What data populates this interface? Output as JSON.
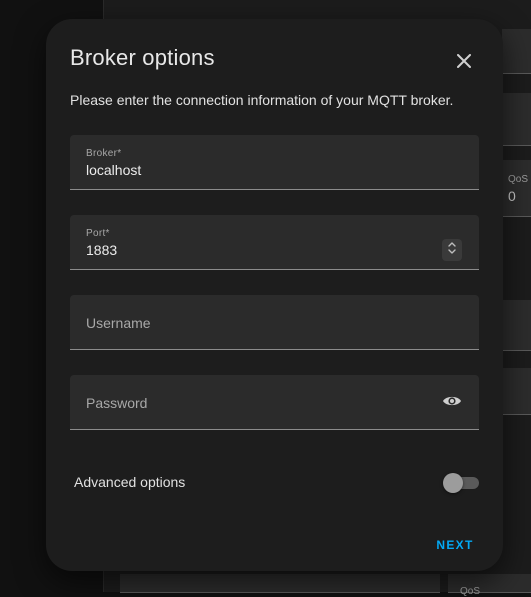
{
  "background": {
    "qos_label": "QoS",
    "qos_value": "0",
    "qos_label_bottom": "QoS"
  },
  "dialog": {
    "title": "Broker options",
    "description": "Please enter the connection information of your MQTT broker.",
    "fields": {
      "broker": {
        "label": "Broker*",
        "value": "localhost"
      },
      "port": {
        "label": "Port*",
        "value": "1883"
      },
      "username": {
        "label": "Username",
        "value": ""
      },
      "password": {
        "label": "Password",
        "value": ""
      }
    },
    "advanced_options": {
      "label": "Advanced options",
      "enabled": false
    },
    "next_label": "NEXT"
  },
  "colors": {
    "accent": "#03a9f4",
    "dialog_bg": "#1d1d1d",
    "field_bg": "#2b2b2b"
  },
  "icons": {
    "close": "close-icon",
    "spinner": "unfold-icon",
    "visibility": "eye-icon"
  }
}
